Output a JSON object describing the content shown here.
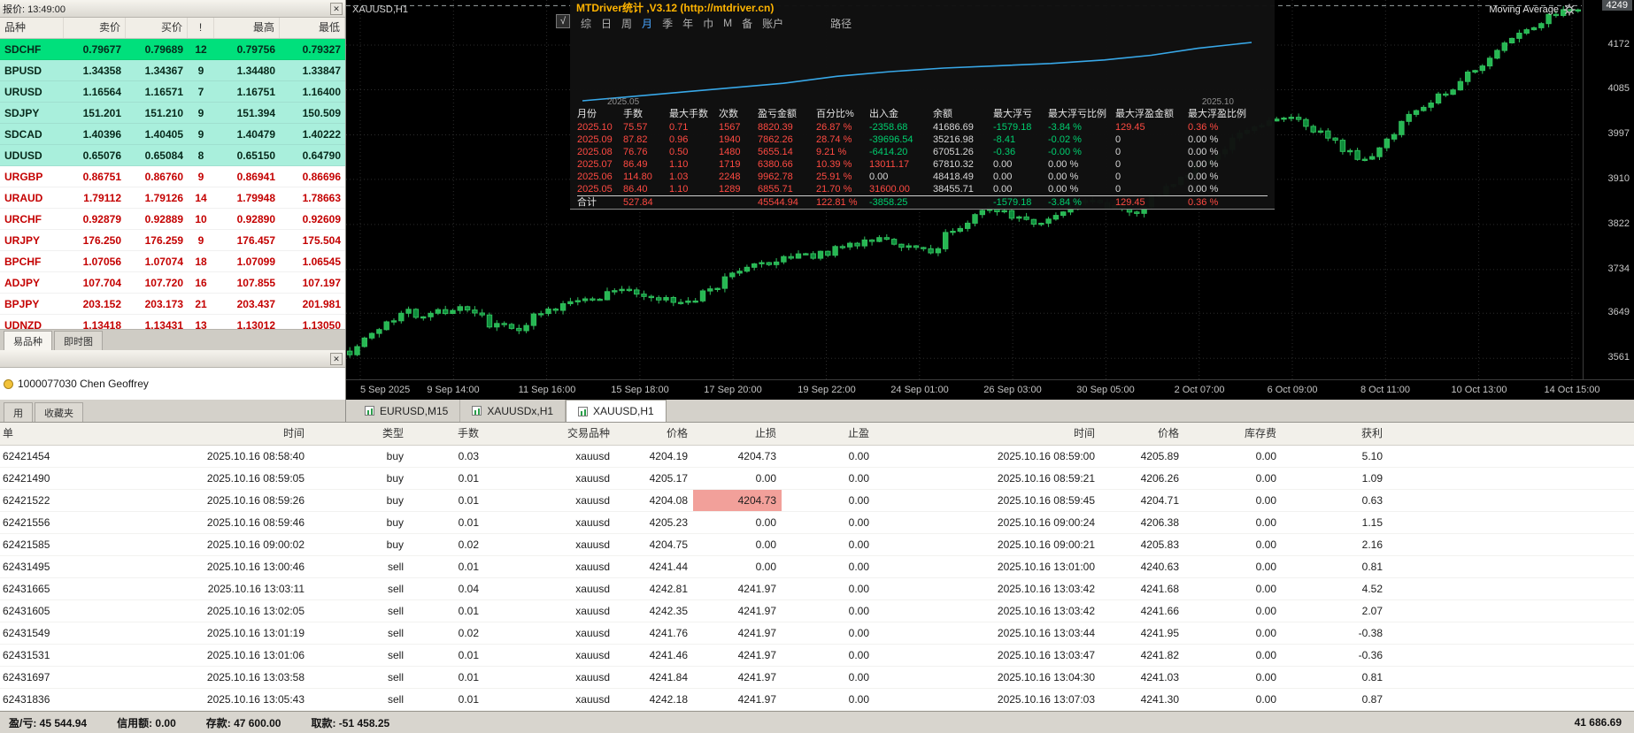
{
  "icons": {
    "close": "✕",
    "check": "√"
  },
  "colors": {
    "stats_red": "#ff4a42",
    "stats_green": "#00cf6f",
    "stats_white": "#d8d8d8",
    "curve_blue": "#38a8e8",
    "candle_green": "#27b853",
    "quote_green_strong": "#00e07c",
    "quote_green_light": "#a9efdc",
    "quote_red_text": "#c40000",
    "sl_highlight": "#f2a09a",
    "title_orange": "#ffb400"
  },
  "market_watch": {
    "title": "报价: 13:49:00",
    "columns": [
      "品种",
      "卖价",
      "买价",
      "!",
      "最高",
      "最低"
    ],
    "rows": [
      {
        "symbol": "SDCHF",
        "bid": "0.79677",
        "ask": "0.79689",
        "spread": "12",
        "high": "0.79756",
        "low": "0.79327",
        "style": "up-strong"
      },
      {
        "symbol": "BPUSD",
        "bid": "1.34358",
        "ask": "1.34367",
        "spread": "9",
        "high": "1.34480",
        "low": "1.33847",
        "style": "up"
      },
      {
        "symbol": "URUSD",
        "bid": "1.16564",
        "ask": "1.16571",
        "spread": "7",
        "high": "1.16751",
        "low": "1.16400",
        "style": "up"
      },
      {
        "symbol": "SDJPY",
        "bid": "151.201",
        "ask": "151.210",
        "spread": "9",
        "high": "151.394",
        "low": "150.509",
        "style": "up"
      },
      {
        "symbol": "SDCAD",
        "bid": "1.40396",
        "ask": "1.40405",
        "spread": "9",
        "high": "1.40479",
        "low": "1.40222",
        "style": "up"
      },
      {
        "symbol": "UDUSD",
        "bid": "0.65076",
        "ask": "0.65084",
        "spread": "8",
        "high": "0.65150",
        "low": "0.64790",
        "style": "up"
      },
      {
        "symbol": "URGBP",
        "bid": "0.86751",
        "ask": "0.86760",
        "spread": "9",
        "high": "0.86941",
        "low": "0.86696",
        "style": "down"
      },
      {
        "symbol": "URAUD",
        "bid": "1.79112",
        "ask": "1.79126",
        "spread": "14",
        "high": "1.79948",
        "low": "1.78663",
        "style": "down"
      },
      {
        "symbol": "URCHF",
        "bid": "0.92879",
        "ask": "0.92889",
        "spread": "10",
        "high": "0.92890",
        "low": "0.92609",
        "style": "down"
      },
      {
        "symbol": "URJPY",
        "bid": "176.250",
        "ask": "176.259",
        "spread": "9",
        "high": "176.457",
        "low": "175.504",
        "style": "down"
      },
      {
        "symbol": "BPCHF",
        "bid": "1.07056",
        "ask": "1.07074",
        "spread": "18",
        "high": "1.07099",
        "low": "1.06545",
        "style": "down"
      },
      {
        "symbol": "ADJPY",
        "bid": "107.704",
        "ask": "107.720",
        "spread": "16",
        "high": "107.855",
        "low": "107.197",
        "style": "down"
      },
      {
        "symbol": "BPJPY",
        "bid": "203.152",
        "ask": "203.173",
        "spread": "21",
        "high": "203.437",
        "low": "201.981",
        "style": "down"
      },
      {
        "symbol": "UDNZD",
        "bid": "1.13418",
        "ask": "1.13431",
        "spread": "13",
        "high": "1.13012",
        "low": "1.13050",
        "style": "down"
      }
    ],
    "tabs": [
      {
        "label": "易品种",
        "active": true
      },
      {
        "label": "即时图",
        "active": false
      }
    ]
  },
  "navigator": {
    "title": "",
    "account": "1000077030 Chen Geoffrey",
    "tabs": [
      "用",
      "收藏夹"
    ]
  },
  "chart": {
    "symbol_label": "XAUUSD,H1",
    "indicator_label": "Moving Average",
    "price_tag": "4249",
    "price_min": 3520,
    "price_max": 4260,
    "axis_prices": [
      "4172",
      "4085",
      "3997",
      "3910",
      "3822",
      "3734",
      "3649",
      "3561"
    ],
    "time_labels": [
      "5 Sep 2025",
      "9 Sep 14:00",
      "11 Sep 16:00",
      "15 Sep 18:00",
      "17 Sep 20:00",
      "19 Sep 22:00",
      "24 Sep 01:00",
      "26 Sep 03:00",
      "30 Sep 05:00",
      "2 Oct 07:00",
      "6 Oct 09:00",
      "8 Oct 11:00",
      "10 Oct 13:00",
      "14 Oct 15:00"
    ],
    "price_path": [
      [
        0,
        3575
      ],
      [
        0.04,
        3648
      ],
      [
        0.09,
        3655
      ],
      [
        0.13,
        3618
      ],
      [
        0.18,
        3668
      ],
      [
        0.22,
        3700
      ],
      [
        0.27,
        3662
      ],
      [
        0.33,
        3745
      ],
      [
        0.38,
        3762
      ],
      [
        0.43,
        3800
      ],
      [
        0.47,
        3768
      ],
      [
        0.52,
        3860
      ],
      [
        0.56,
        3825
      ],
      [
        0.6,
        3868
      ],
      [
        0.64,
        3850
      ],
      [
        0.68,
        3920
      ],
      [
        0.72,
        3990
      ],
      [
        0.76,
        4035
      ],
      [
        0.8,
        3985
      ],
      [
        0.83,
        3945
      ],
      [
        0.86,
        4040
      ],
      [
        0.9,
        4090
      ],
      [
        0.93,
        4150
      ],
      [
        0.96,
        4205
      ],
      [
        1.0,
        4246
      ]
    ]
  },
  "stats_panel": {
    "title": "MTDriver统计 ,V3.12 (http://mtdriver.cn)",
    "menu": [
      "综",
      "日",
      "周",
      "月",
      "季",
      "年",
      "巾",
      "M",
      "备",
      "账户"
    ],
    "menu_active": "月",
    "path_label": "路径",
    "curve_labels": {
      "start": "2025.05",
      "end": "2025.10"
    },
    "curve_points": [
      [
        0,
        0
      ],
      [
        0.07,
        0.07
      ],
      [
        0.15,
        0.15
      ],
      [
        0.23,
        0.23
      ],
      [
        0.3,
        0.3
      ],
      [
        0.38,
        0.42
      ],
      [
        0.46,
        0.5
      ],
      [
        0.54,
        0.56
      ],
      [
        0.62,
        0.6
      ],
      [
        0.7,
        0.64
      ],
      [
        0.78,
        0.7
      ],
      [
        0.85,
        0.78
      ],
      [
        0.92,
        0.9
      ],
      [
        1,
        1
      ]
    ],
    "columns": [
      "月份",
      "手数",
      "最大手数",
      "次数",
      "盈亏金额",
      "百分比%",
      "出入金",
      "余额",
      "最大浮亏",
      "最大浮亏比例",
      "最大浮盈金额",
      "最大浮盈比例"
    ],
    "rows": [
      [
        "2025.10",
        "75.57",
        "0.71",
        "1567",
        "8820.39",
        "26.87 %",
        "-2358.68",
        "41686.69",
        "-1579.18",
        "-3.84 %",
        "129.45",
        "0.36 %"
      ],
      [
        "2025.09",
        "87.82",
        "0.96",
        "1940",
        "7862.26",
        "28.74 %",
        "-39696.54",
        "35216.98",
        "-8.41",
        "-0.02 %",
        "0",
        "0.00 %"
      ],
      [
        "2025.08",
        "76.76",
        "0.50",
        "1480",
        "5655.14",
        "9.21 %",
        "-6414.20",
        "67051.26",
        "-0.36",
        "-0.00 %",
        "0",
        "0.00 %"
      ],
      [
        "2025.07",
        "86.49",
        "1.10",
        "1719",
        "6380.66",
        "10.39 %",
        "13011.17",
        "67810.32",
        "0.00",
        "0.00 %",
        "0",
        "0.00 %"
      ],
      [
        "2025.06",
        "114.80",
        "1.03",
        "2248",
        "9962.78",
        "25.91 %",
        "0.00",
        "48418.49",
        "0.00",
        "0.00 %",
        "0",
        "0.00 %"
      ],
      [
        "2025.05",
        "86.40",
        "1.10",
        "1289",
        "6855.71",
        "21.70 %",
        "31600.00",
        "38455.71",
        "0.00",
        "0.00 %",
        "0",
        "0.00 %"
      ]
    ],
    "total": [
      "合计",
      "527.84",
      "",
      "",
      "45544.94",
      "122.81 %",
      "-3858.25",
      "",
      "-1579.18",
      "-3.84 %",
      "129.45",
      "0.36 %"
    ]
  },
  "chart_tabs": [
    {
      "label": "EURUSD,M15",
      "active": false
    },
    {
      "label": "XAUUSDx,H1",
      "active": false
    },
    {
      "label": "XAUUSD,H1",
      "active": true
    }
  ],
  "terminal": {
    "columns": [
      "单",
      "时间",
      "类型",
      "手数",
      "交易品种",
      "价格",
      "止损",
      "止盈",
      "时间",
      "价格",
      "库存费",
      "获利"
    ],
    "rows": [
      {
        "cells": [
          "62421454",
          "2025.10.16 08:58:40",
          "buy",
          "0.03",
          "xauusd",
          "4204.19",
          "4204.73",
          "0.00",
          "2025.10.16 08:59:00",
          "4205.89",
          "0.00",
          "5.10"
        ]
      },
      {
        "cells": [
          "62421490",
          "2025.10.16 08:59:05",
          "buy",
          "0.01",
          "xauusd",
          "4205.17",
          "0.00",
          "0.00",
          "2025.10.16 08:59:21",
          "4206.26",
          "0.00",
          "1.09"
        ]
      },
      {
        "cells": [
          "62421522",
          "2025.10.16 08:59:26",
          "buy",
          "0.01",
          "xauusd",
          "4204.08",
          "4204.73",
          "0.00",
          "2025.10.16 08:59:45",
          "4204.71",
          "0.00",
          "0.63"
        ],
        "sl_highlight": true
      },
      {
        "cells": [
          "62421556",
          "2025.10.16 08:59:46",
          "buy",
          "0.01",
          "xauusd",
          "4205.23",
          "0.00",
          "0.00",
          "2025.10.16 09:00:24",
          "4206.38",
          "0.00",
          "1.15"
        ]
      },
      {
        "cells": [
          "62421585",
          "2025.10.16 09:00:02",
          "buy",
          "0.02",
          "xauusd",
          "4204.75",
          "0.00",
          "0.00",
          "2025.10.16 09:00:21",
          "4205.83",
          "0.00",
          "2.16"
        ]
      },
      {
        "cells": [
          "62431495",
          "2025.10.16 13:00:46",
          "sell",
          "0.01",
          "xauusd",
          "4241.44",
          "0.00",
          "0.00",
          "2025.10.16 13:01:00",
          "4240.63",
          "0.00",
          "0.81"
        ]
      },
      {
        "cells": [
          "62431665",
          "2025.10.16 13:03:11",
          "sell",
          "0.04",
          "xauusd",
          "4242.81",
          "4241.97",
          "0.00",
          "2025.10.16 13:03:42",
          "4241.68",
          "0.00",
          "4.52"
        ]
      },
      {
        "cells": [
          "62431605",
          "2025.10.16 13:02:05",
          "sell",
          "0.01",
          "xauusd",
          "4242.35",
          "4241.97",
          "0.00",
          "2025.10.16 13:03:42",
          "4241.66",
          "0.00",
          "2.07"
        ]
      },
      {
        "cells": [
          "62431549",
          "2025.10.16 13:01:19",
          "sell",
          "0.02",
          "xauusd",
          "4241.76",
          "4241.97",
          "0.00",
          "2025.10.16 13:03:44",
          "4241.95",
          "0.00",
          "-0.38"
        ]
      },
      {
        "cells": [
          "62431531",
          "2025.10.16 13:01:06",
          "sell",
          "0.01",
          "xauusd",
          "4241.46",
          "4241.97",
          "0.00",
          "2025.10.16 13:03:47",
          "4241.82",
          "0.00",
          "-0.36"
        ]
      },
      {
        "cells": [
          "62431697",
          "2025.10.16 13:03:58",
          "sell",
          "0.01",
          "xauusd",
          "4241.84",
          "4241.97",
          "0.00",
          "2025.10.16 13:04:30",
          "4241.03",
          "0.00",
          "0.81"
        ]
      },
      {
        "cells": [
          "62431836",
          "2025.10.16 13:05:43",
          "sell",
          "0.01",
          "xauusd",
          "4242.18",
          "4241.97",
          "0.00",
          "2025.10.16 13:07:03",
          "4241.30",
          "0.00",
          "0.87"
        ]
      }
    ]
  },
  "status_bar": {
    "profit": "盈/亏: 45 544.94",
    "credit": "信用额: 0.00",
    "deposit": "存款: 47 600.00",
    "withdraw": "取款: -51 458.25",
    "balance": "41 686.69"
  }
}
